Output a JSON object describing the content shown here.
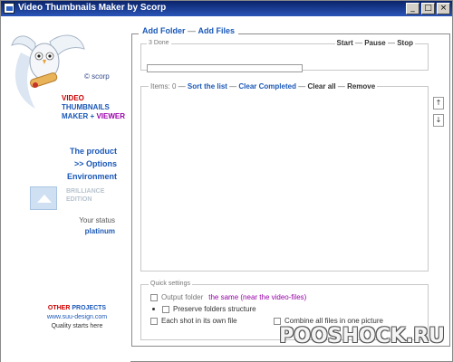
{
  "window": {
    "title": "Video Thumbnails Maker by Scorp",
    "btn_minimize": "_",
    "btn_maximize": "□",
    "btn_close": "×"
  },
  "sidebar": {
    "copyright": "© scorp",
    "product_line1": "VIDEO",
    "product_line2": "THUMBNAILS",
    "product_line3a": "MAKER + ",
    "product_line3b": "VIEWER",
    "nav": [
      "The product",
      ">> Options",
      "Environment"
    ],
    "brilliance_line1": "BRILLIANCE",
    "brilliance_line2": "EDITION",
    "status_label": "Your status",
    "status_value": "platinum",
    "other_a": "OTHER ",
    "other_b": "PROJECTS",
    "site": "www.suu-design.com",
    "slogan": "Quality starts here"
  },
  "main": {
    "add_folder": "Add Folder",
    "add_files": "Add Files",
    "done_label": "3 Done",
    "start": "Start",
    "pause": "Pause",
    "stop": "Stop",
    "items_count": "Items: 0",
    "sort_list": "Sort the list",
    "clear_completed": "Clear Completed",
    "clear_all": "Clear all",
    "remove": "Remove",
    "move_up": "↑",
    "move_down": "↓"
  },
  "quick": {
    "legend": "Quick settings",
    "output_folder": "Output folder",
    "output_value": "the same (near the video-files)",
    "preserve": "Preserve folders structure",
    "each_shot": "Each shot in its own file",
    "combine": "Combine all files in one picture"
  },
  "watermark": "POOSHOCK.RU"
}
